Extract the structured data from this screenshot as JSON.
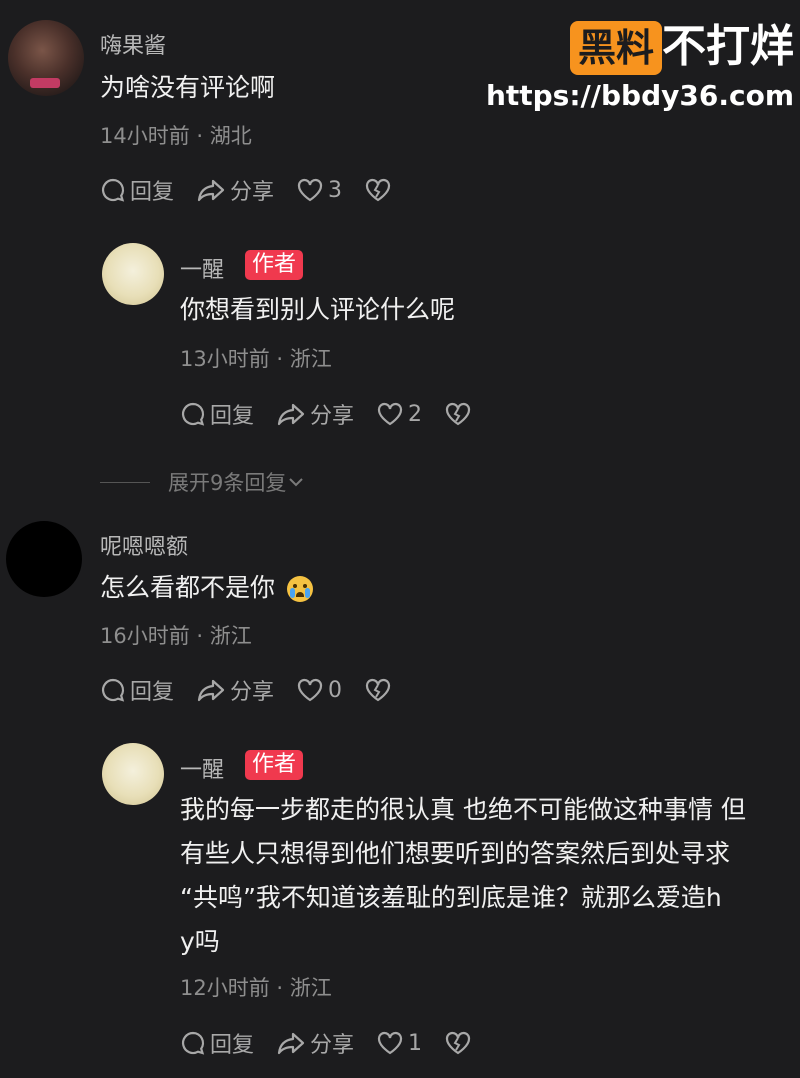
{
  "watermark": {
    "brand_box": "黑料",
    "brand_tail": "不打烊",
    "url": "https://bbdy36.com"
  },
  "comments": [
    {
      "username": "嗨果酱",
      "text": "为啥没有评论啊",
      "time_location": "14小时前 · 湖北",
      "actions": {
        "reply": "回复",
        "share": "分享",
        "likes": "3"
      },
      "reply": {
        "username": "一醒",
        "badge": "作者",
        "text": "你想看到别人评论什么呢",
        "time_location": "13小时前 · 浙江",
        "actions": {
          "reply": "回复",
          "share": "分享",
          "likes": "2"
        }
      },
      "expand_label": "展开9条回复"
    },
    {
      "username": "呢嗯嗯额",
      "text": "怎么看都不是你",
      "time_location": "16小时前 · 浙江",
      "actions": {
        "reply": "回复",
        "share": "分享",
        "likes": "0"
      },
      "reply": {
        "username": "一醒",
        "badge": "作者",
        "text_lines": [
          "我的每一步都走的很认真 也绝不可能做这种事情 但",
          "有些人只想得到他们想要听到的答案然后到处寻求",
          "“共鸣”我不知道该羞耻的到底是谁？就那么爱造h",
          "y吗"
        ],
        "time_location": "12小时前 · 浙江",
        "actions": {
          "reply": "回复",
          "share": "分享",
          "likes": "1"
        }
      }
    }
  ],
  "icons": {
    "reply": "comment-bubble-icon",
    "share": "share-arrow-icon",
    "like": "heart-icon",
    "dislike": "broken-heart-icon",
    "expand": "chevron-down-icon",
    "emoji": "crying-face-emoji"
  },
  "colors": {
    "background": "#1c1c1e",
    "author_badge": "#f0394e",
    "watermark_box": "#f7931e"
  }
}
